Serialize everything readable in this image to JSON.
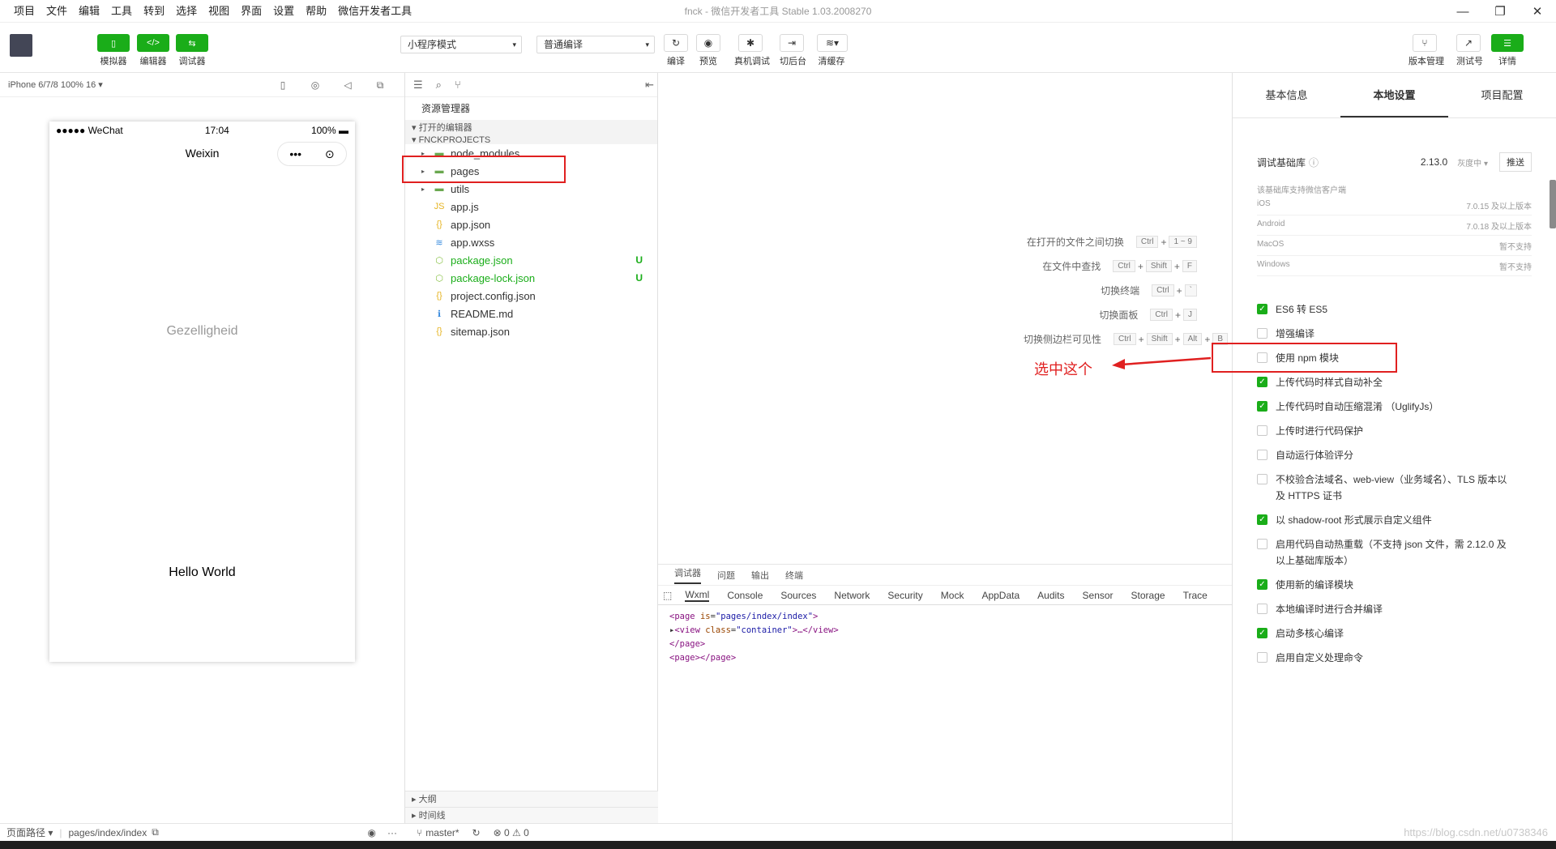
{
  "window": {
    "title": "fnck - 微信开发者工具 Stable 1.03.2008270",
    "controls": [
      "—",
      "❐",
      "✕"
    ]
  },
  "menu": [
    "项目",
    "文件",
    "编辑",
    "工具",
    "转到",
    "选择",
    "视图",
    "界面",
    "设置",
    "帮助",
    "微信开发者工具"
  ],
  "toolbar": {
    "simulator": "模拟器",
    "editor": "编辑器",
    "debugger": "调试器",
    "mode_select": "小程序模式",
    "compile_select": "普通编译",
    "compile": "编译",
    "preview": "预览",
    "remote_debug": "真机调试",
    "background": "切后台",
    "clear_cache": "清缓存",
    "version_mgmt": "版本管理",
    "test_account": "测试号",
    "details": "详情"
  },
  "simulator": {
    "device": "iPhone 6/7/8 100% 16 ▾",
    "status_left": "●●●●● WeChat",
    "status_time": "17:04",
    "status_batt": "100%",
    "nav_title": "Weixin",
    "middle_text": "Gezelligheid",
    "hello_text": "Hello World",
    "footer_path_label": "页面路径 ▾",
    "footer_path": "pages/index/index"
  },
  "explorer": {
    "title": "资源管理器",
    "open_editors": "打开的编辑器",
    "project": "FNCKPROJECTS",
    "files": [
      {
        "name": "node_modules",
        "icon": "▬",
        "twisty": "▸",
        "status": ""
      },
      {
        "name": "pages",
        "icon": "▬",
        "twisty": "▸",
        "status": ""
      },
      {
        "name": "utils",
        "icon": "▬",
        "twisty": "▸",
        "status": ""
      },
      {
        "name": "app.js",
        "icon": "JS",
        "twisty": "",
        "status": ""
      },
      {
        "name": "app.json",
        "icon": "{}",
        "twisty": "",
        "status": ""
      },
      {
        "name": "app.wxss",
        "icon": "≋",
        "twisty": "",
        "status": ""
      },
      {
        "name": "package.json",
        "icon": "⬡",
        "twisty": "",
        "status": "U"
      },
      {
        "name": "package-lock.json",
        "icon": "⬡",
        "twisty": "",
        "status": "U"
      },
      {
        "name": "project.config.json",
        "icon": "{}",
        "twisty": "",
        "status": ""
      },
      {
        "name": "README.md",
        "icon": "ℹ",
        "twisty": "",
        "status": ""
      },
      {
        "name": "sitemap.json",
        "icon": "{}",
        "twisty": "",
        "status": ""
      }
    ],
    "outline": "大纲",
    "timeline": "时间线"
  },
  "statusbar": {
    "branch": "master*",
    "errors": "⊗ 0 ⚠ 0"
  },
  "editor": {
    "shortcuts": [
      {
        "label": "在打开的文件之间切换",
        "keys": [
          "Ctrl",
          "1 ~ 9"
        ]
      },
      {
        "label": "在文件中查找",
        "keys": [
          "Ctrl",
          "Shift",
          "F"
        ]
      },
      {
        "label": "切换终端",
        "keys": [
          "Ctrl",
          "`"
        ]
      },
      {
        "label": "切换面板",
        "keys": [
          "Ctrl",
          "J"
        ]
      },
      {
        "label": "切换侧边栏可见性",
        "keys": [
          "Ctrl",
          "Shift",
          "Alt",
          "B"
        ]
      }
    ]
  },
  "debug": {
    "tabs": [
      "调试器",
      "问题",
      "输出",
      "终端"
    ],
    "subtabs": [
      "Wxml",
      "Console",
      "Sources",
      "Network",
      "Security",
      "Mock",
      "AppData",
      "Audits",
      "Sensor",
      "Storage",
      "Trace"
    ],
    "code": {
      "l1_tag": "page",
      "l1_attr": "is",
      "l1_val": "\"pages/index/index\"",
      "l2_tag": "view",
      "l2_attr": "class",
      "l2_val": "\"container\"",
      "l2_end": "…</view>",
      "l3": "</page>",
      "l4": "<page></page>"
    }
  },
  "settings": {
    "tabs": [
      "基本信息",
      "本地设置",
      "项目配置"
    ],
    "lib_label": "调试基础库",
    "lib_version": "2.13.0",
    "lib_gray": "灰度中 ▾",
    "push": "推送",
    "support_title": "该基础库支持微信客户端",
    "platforms": [
      {
        "name": "iOS",
        "val": "7.0.15 及以上版本"
      },
      {
        "name": "Android",
        "val": "7.0.18 及以上版本"
      },
      {
        "name": "MacOS",
        "val": "暂不支持"
      },
      {
        "name": "Windows",
        "val": "暂不支持"
      }
    ],
    "options": [
      {
        "label": "ES6 转 ES5",
        "checked": true
      },
      {
        "label": "增强编译",
        "checked": false
      },
      {
        "label": "使用 npm 模块",
        "checked": false
      },
      {
        "label": "上传代码时样式自动补全",
        "checked": true
      },
      {
        "label": "上传代码时自动压缩混淆 （UglifyJs）",
        "checked": true
      },
      {
        "label": "上传时进行代码保护",
        "checked": false
      },
      {
        "label": "自动运行体验评分",
        "checked": false
      },
      {
        "label": "不校验合法域名、web-view（业务域名）、TLS 版本以及 HTTPS 证书",
        "checked": false
      },
      {
        "label": "以 shadow-root 形式展示自定义组件",
        "checked": true
      },
      {
        "label": "启用代码自动热重载（不支持 json 文件，需 2.12.0 及以上基础库版本）",
        "checked": false
      },
      {
        "label": "使用新的编译模块",
        "checked": true
      },
      {
        "label": "本地编译时进行合并编译",
        "checked": false
      },
      {
        "label": "启动多核心编译",
        "checked": true
      },
      {
        "label": "启用自定义处理命令",
        "checked": false
      }
    ]
  },
  "annotation": {
    "text": "选中这个"
  },
  "watermark": "https://blog.csdn.net/u0738346",
  "colors": {
    "accent": "#1aad19",
    "annotation": "#e02020"
  }
}
